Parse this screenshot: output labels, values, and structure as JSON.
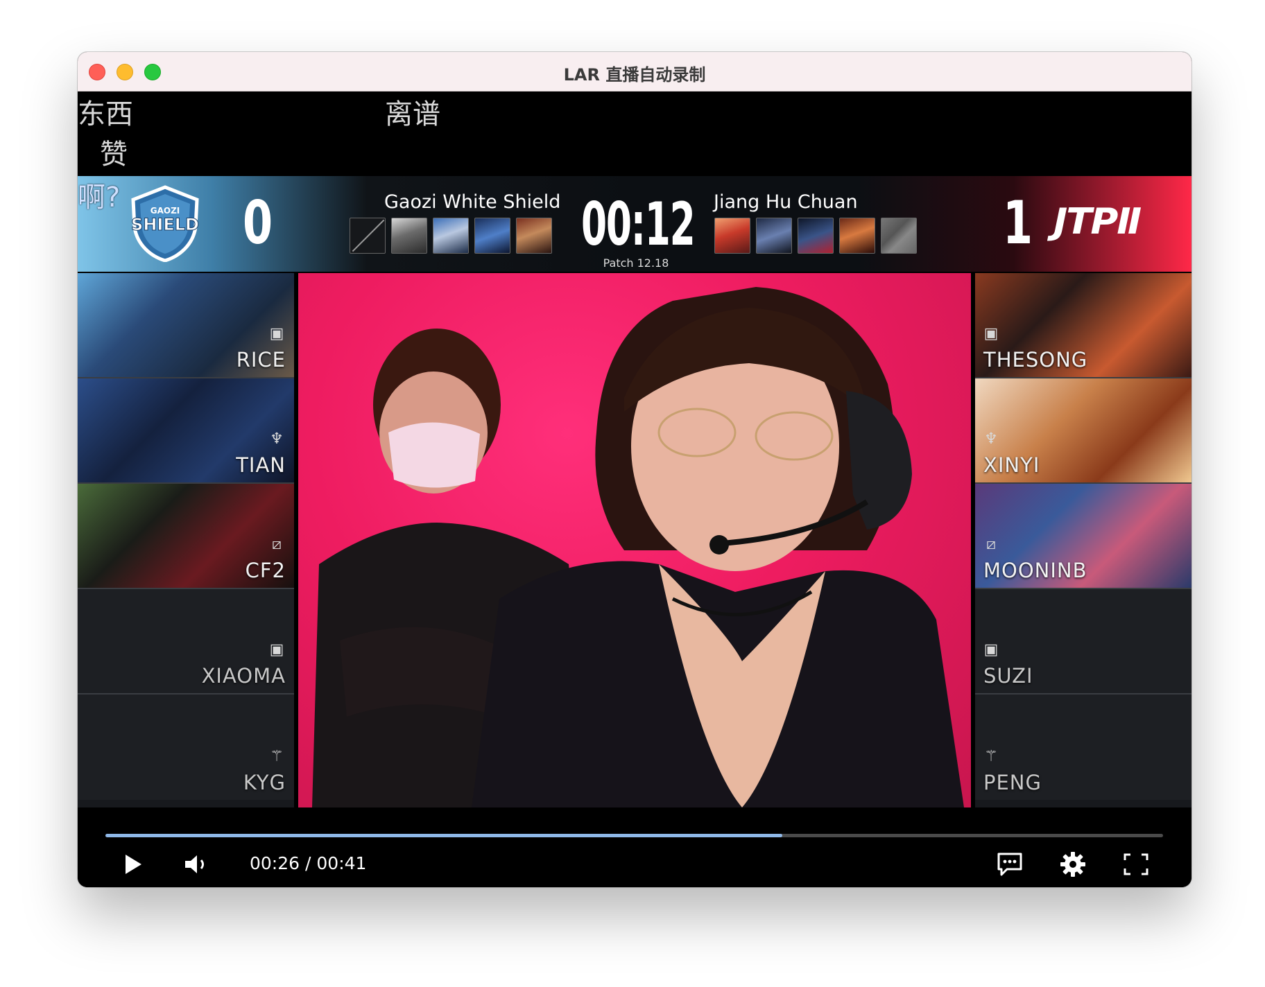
{
  "window": {
    "title": "LAR 直播自动录制"
  },
  "danmaku": [
    "东西",
    "赞",
    "离谱",
    "啊?"
  ],
  "scoreboard": {
    "left_team": {
      "name": "Gaozi White Shield",
      "score": "0",
      "logo_top": "GAOZI",
      "logo_main": "SHIELD"
    },
    "right_team": {
      "name": "Jiang Hu Chuan",
      "score": "1",
      "logo": "JTPⅡ"
    },
    "game_time": "00:12",
    "patch": "Patch 12.18"
  },
  "left_players": [
    {
      "name": "RICE",
      "role_icon": "top-lane-icon"
    },
    {
      "name": "TIAN",
      "role_icon": "jungle-icon"
    },
    {
      "name": "CF2",
      "role_icon": "mid-lane-icon"
    },
    {
      "name": "XIAOMA",
      "role_icon": "bot-lane-icon"
    },
    {
      "name": "KYG",
      "role_icon": "support-icon"
    }
  ],
  "right_players": [
    {
      "name": "THESONG",
      "role_icon": "top-lane-icon"
    },
    {
      "name": "XINYI",
      "role_icon": "jungle-icon"
    },
    {
      "name": "MOONINB",
      "role_icon": "mid-lane-icon"
    },
    {
      "name": "SUZI",
      "role_icon": "bot-lane-icon"
    },
    {
      "name": "PENG",
      "role_icon": "support-icon"
    }
  ],
  "player": {
    "current_time": "00:26",
    "separator": "/",
    "duration": "00:41",
    "progress": 0.64
  },
  "colors": {
    "accent_progress": "#8fb8e8",
    "left_team": "#7fc4e8",
    "right_team": "#ff2848"
  }
}
